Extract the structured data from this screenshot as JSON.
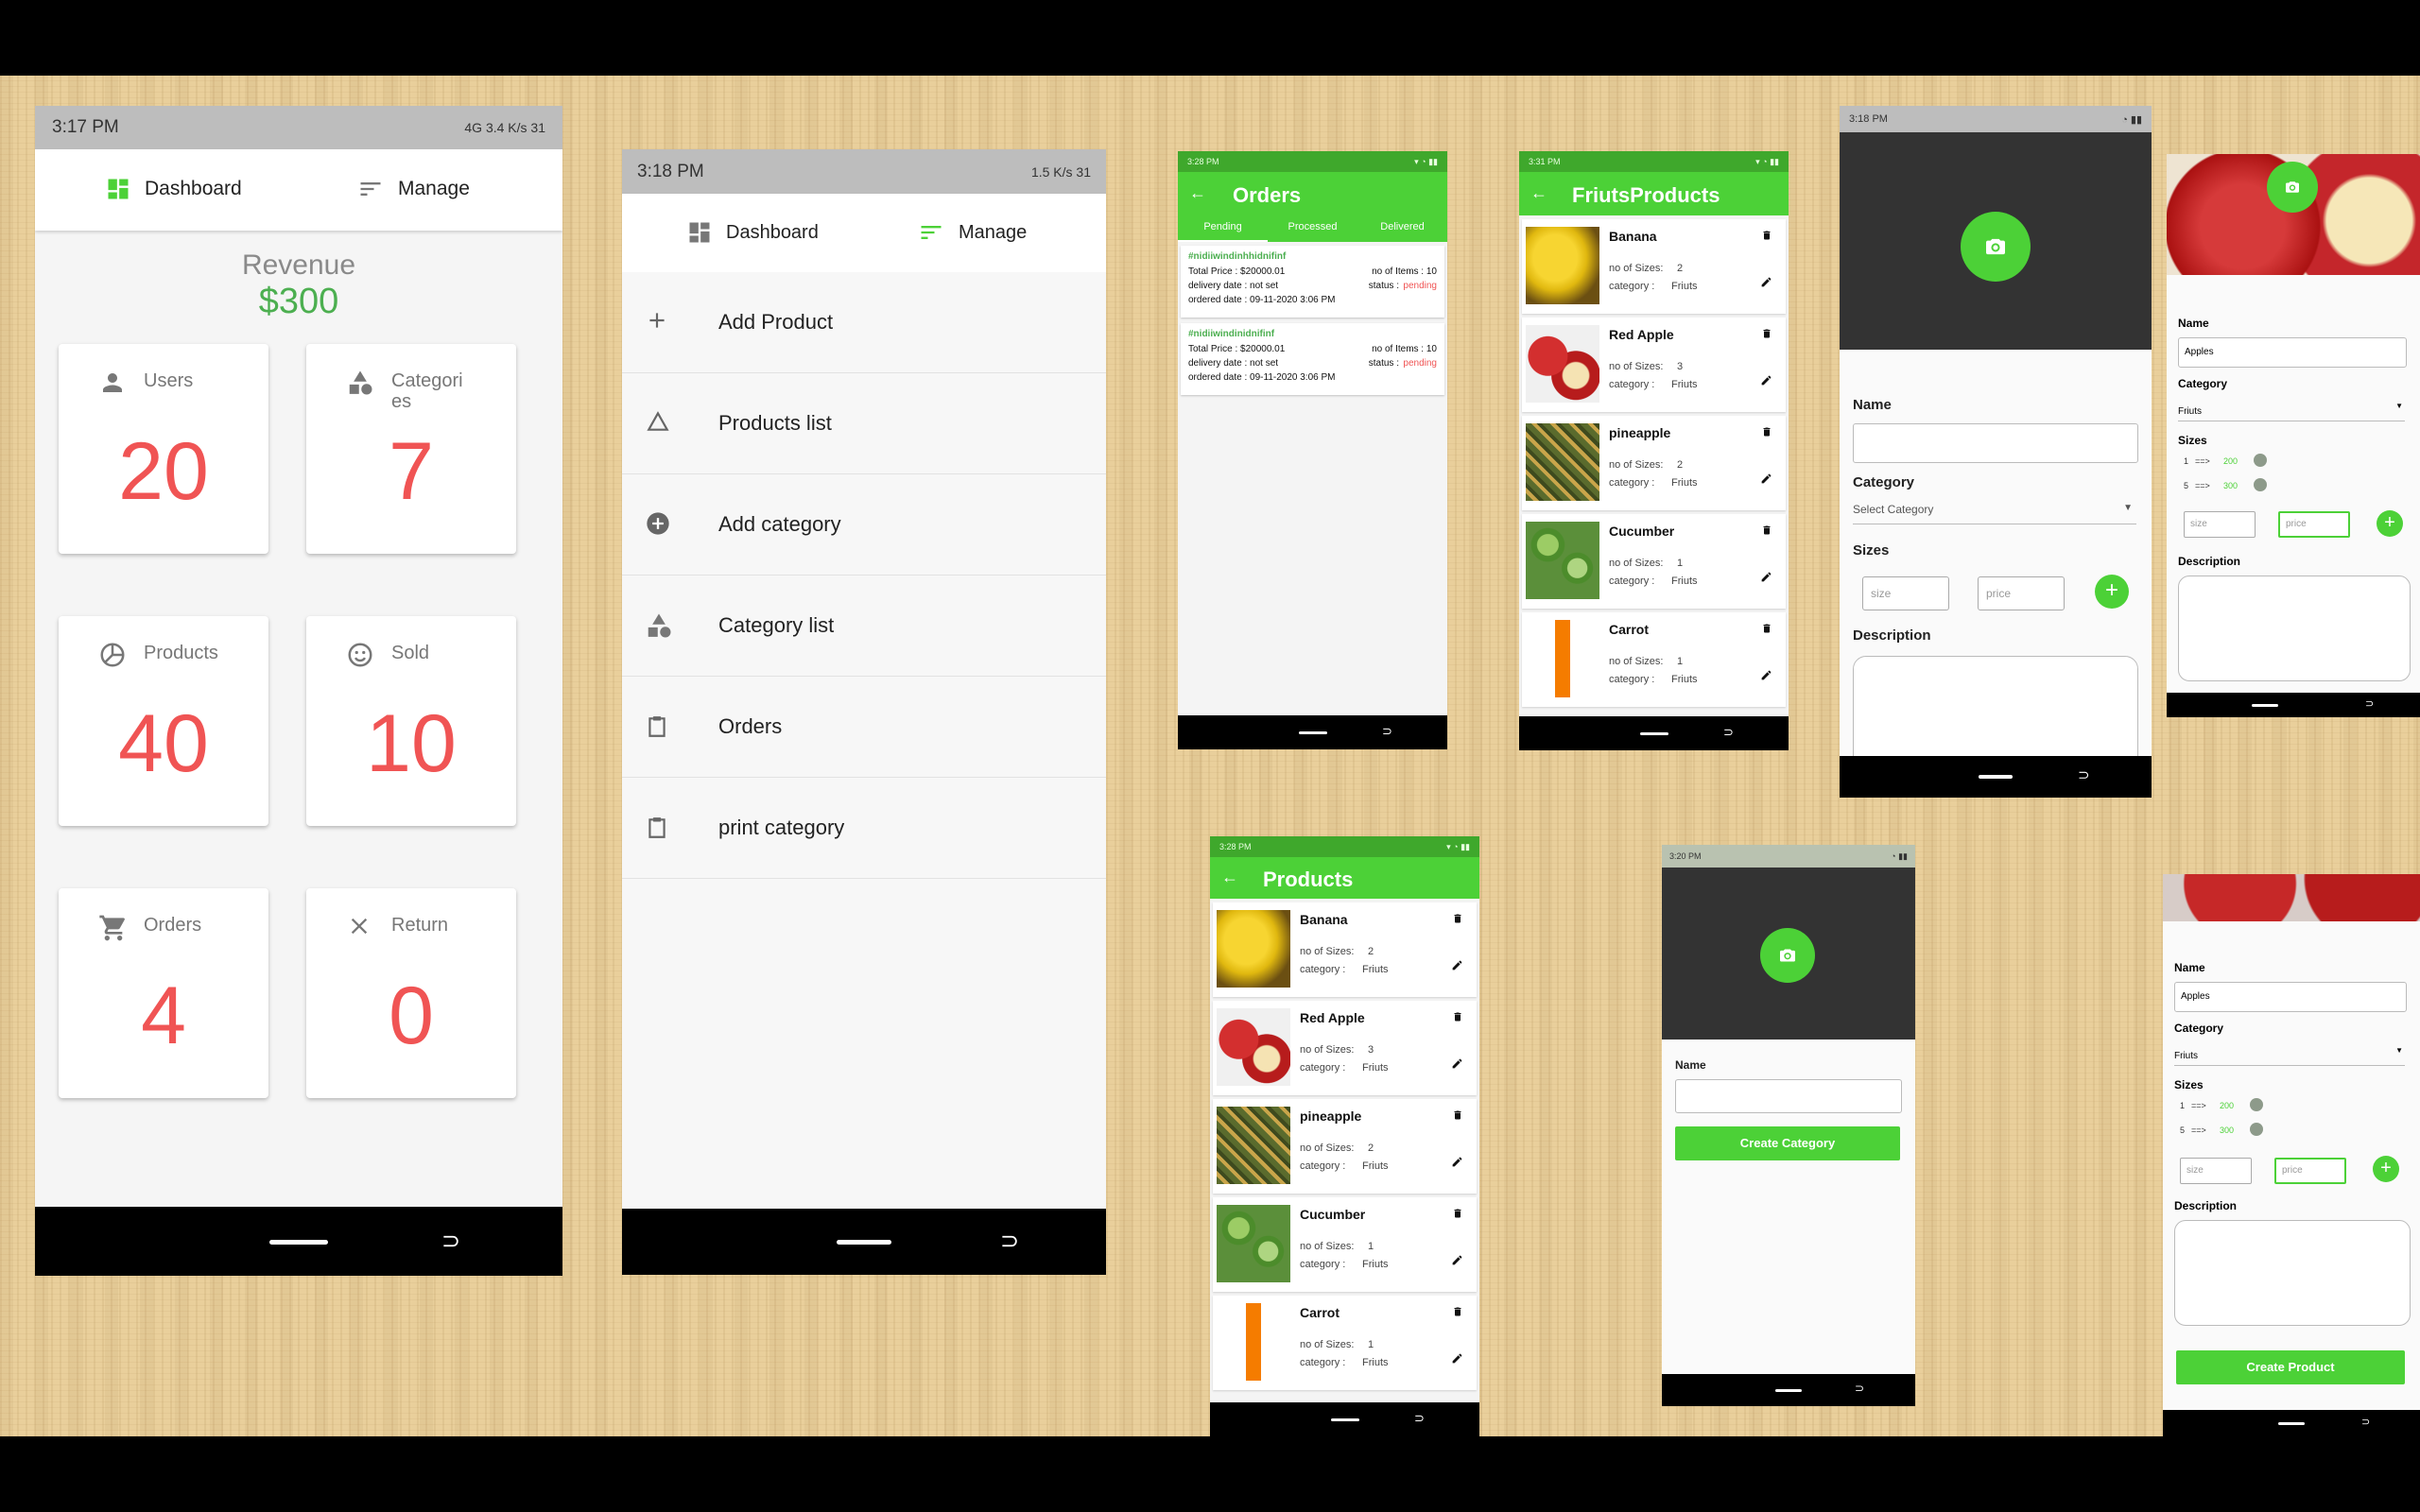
{
  "colors": {
    "accent": "#4cd137",
    "stat_number": "#f05454",
    "status_pending": "#f05454",
    "wood": "#e9cf9b"
  },
  "dashboard": {
    "status": {
      "time": "3:17 PM",
      "right": "4G 3.4 K/s 31"
    },
    "tabs": {
      "dashboard": "Dashboard",
      "manage": "Manage"
    },
    "revenue_label": "Revenue",
    "revenue_value": "$300",
    "cards": [
      {
        "icon": "person-icon",
        "label": "Users",
        "value": "20"
      },
      {
        "icon": "shapes-icon",
        "label": "Categori es",
        "value": "7"
      },
      {
        "icon": "pie-icon",
        "label": "Products",
        "value": "40"
      },
      {
        "icon": "smile-icon",
        "label": "Sold",
        "value": "10"
      },
      {
        "icon": "cart-icon",
        "label": "Orders",
        "value": "4"
      },
      {
        "icon": "close-icon",
        "label": "Return",
        "value": "0"
      }
    ]
  },
  "manage": {
    "status": {
      "time": "3:18 PM",
      "right": "1.5 K/s 31"
    },
    "tabs": {
      "dashboard": "Dashboard",
      "manage": "Manage"
    },
    "items": [
      {
        "icon": "plus-icon",
        "label": "Add Product"
      },
      {
        "icon": "triangle-icon",
        "label": "Products list"
      },
      {
        "icon": "add-circle-icon",
        "label": "Add category"
      },
      {
        "icon": "shapes-icon",
        "label": "Category list"
      },
      {
        "icon": "clipboard-icon",
        "label": "Orders"
      },
      {
        "icon": "clipboard-icon",
        "label": "print category"
      }
    ]
  },
  "orders": {
    "status": {
      "time": "3:28 PM"
    },
    "title": "Orders",
    "tabs": [
      "Pending",
      "Processed",
      "Delivered"
    ],
    "list": [
      {
        "id": "#nidiiwindinhhidnifinf",
        "total": "Total Price : $20000.01",
        "items": "no of Items : 10",
        "delivery": "delivery date : not set",
        "status_label": "status :",
        "status": "pending",
        "ordered": "ordered date : 09-11-2020 3:06 PM"
      },
      {
        "id": "#nidiiwindinidnifinf",
        "total": "Total Price : $20000.01",
        "items": "no of Items : 10",
        "delivery": "delivery date : not set",
        "status_label": "status :",
        "status": "pending",
        "ordered": "ordered date : 09-11-2020 3:06 PM"
      }
    ]
  },
  "products": [
    {
      "name": "Banana",
      "sizes_label": "no of Sizes:",
      "sizes": "2",
      "cat_label": "category :",
      "category": "Friuts"
    },
    {
      "name": "Red Apple",
      "sizes_label": "no of Sizes:",
      "sizes": "3",
      "cat_label": "category :",
      "category": "Friuts"
    },
    {
      "name": "pineapple",
      "sizes_label": "no of Sizes:",
      "sizes": "2",
      "cat_label": "category :",
      "category": "Friuts"
    },
    {
      "name": "Cucumber",
      "sizes_label": "no of Sizes:",
      "sizes": "1",
      "cat_label": "category :",
      "category": "Friuts"
    },
    {
      "name": "Carrot",
      "sizes_label": "no of Sizes:",
      "sizes": "1",
      "cat_label": "category :",
      "category": "Friuts"
    }
  ],
  "friuts_products": {
    "status": {
      "time": "3:31 PM"
    },
    "title": "FriutsProducts"
  },
  "products_screen": {
    "status": {
      "time": "3:28 PM"
    },
    "title": "Products"
  },
  "add_product_empty": {
    "status": {
      "time": "3:18 PM"
    },
    "name_label": "Name",
    "category_label": "Category",
    "category_placeholder": "Select Category",
    "sizes_label": "Sizes",
    "size_placeholder": "size",
    "price_placeholder": "price",
    "description_label": "Description"
  },
  "create_category": {
    "status": {
      "time": "3:20 PM"
    },
    "name_label": "Name",
    "button": "Create Category"
  },
  "edit_product": {
    "name_label": "Name",
    "name_value": "Apples",
    "category_label": "Category",
    "category_value": "Friuts",
    "sizes_label": "Sizes",
    "sizes": [
      {
        "size": "1",
        "arrow": "==>",
        "price": "200"
      },
      {
        "size": "5",
        "arrow": "==>",
        "price": "300"
      }
    ],
    "size_placeholder": "size",
    "price_placeholder": "price",
    "description_label": "Description",
    "button": "Create Product"
  }
}
